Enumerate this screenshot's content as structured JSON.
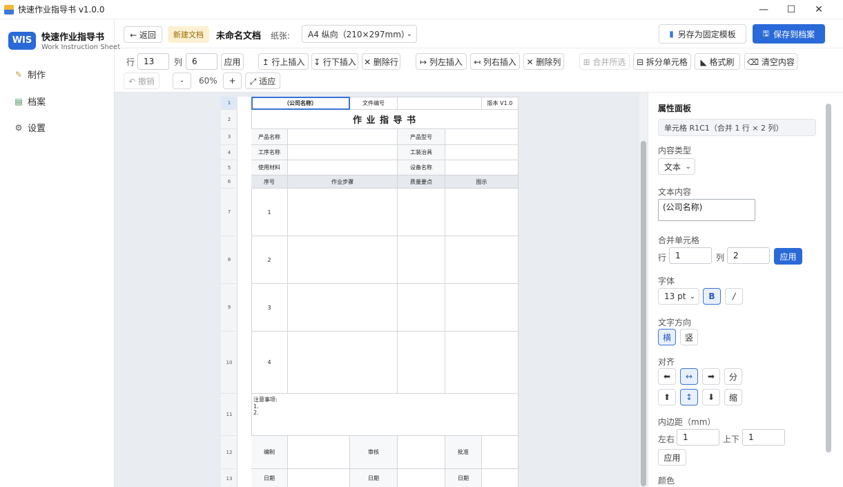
{
  "window": {
    "title": "快速作业指导书 v1.0.0",
    "minimize": "—",
    "maximize": "☐",
    "close": "✕"
  },
  "brand": {
    "logo": "WIS",
    "title": "快速作业指导书",
    "subtitle": "Work Instruction Sheet"
  },
  "nav": [
    {
      "icon": "pencil-icon",
      "glyph": "✎",
      "label": "制作"
    },
    {
      "icon": "archive-icon",
      "glyph": "▤",
      "label": "档案"
    },
    {
      "icon": "gear-icon",
      "glyph": "⚙",
      "label": "设置"
    }
  ],
  "top": {
    "back": "← 返回",
    "badge": "新建文档",
    "doc_title": "未命名文档",
    "paper_label": "纸张:",
    "paper_value": "A4 纵向（210×297mm）",
    "save_template": "另存为固定模板",
    "save_archive": "保存到档案"
  },
  "toolbar": {
    "row_label": "行",
    "row_value": "13",
    "col_label": "列",
    "col_value": "6",
    "apply": "应用",
    "insert_row_above": "↥ 行上插入",
    "insert_row_below": "↧ 行下插入",
    "delete_row": "✕ 删除行",
    "insert_col_left": "↦ 列左插入",
    "insert_col_right": "↤ 列右插入",
    "delete_col": "✕ 删除列",
    "merge": "⊞ 合并所选",
    "split": "⊟ 拆分单元格",
    "format_painter": "◣ 格式刷",
    "clear": "⌫ 清空内容",
    "undo": "↶ 撤销",
    "zoom_out": "-",
    "zoom": "60%",
    "zoom_in": "+",
    "fit": "⤢ 适应"
  },
  "sheet": {
    "rownums": [
      "1",
      "2",
      "3",
      "4",
      "5",
      "6",
      "7",
      "8",
      "9",
      "10",
      "11",
      "12",
      "13"
    ],
    "company": "（公司名称）",
    "doc_no_label": "文件编号",
    "version": "版本 V1.0",
    "title": "作 业 指 导 书",
    "product_name": "产品名称",
    "product_model": "产品型号",
    "process_name": "工序名称",
    "fixture": "工装治具",
    "material": "使用材料",
    "equipment": "设备名称",
    "h_no": "序号",
    "h_step": "作业步骤",
    "h_quality": "质量要点",
    "h_diagram": "图示",
    "steps": [
      "1",
      "2",
      "3",
      "4"
    ],
    "notes_title": "注意事项:",
    "note1": "1.",
    "note2": "2.",
    "prepare": "编制",
    "review": "审核",
    "approve": "批准",
    "date1": "日期",
    "date2": "日期",
    "date3": "日期"
  },
  "panel": {
    "title": "属性面板",
    "cell_info": "单元格 R1C1（合并 1 行 × 2 列）",
    "content_type_label": "内容类型",
    "content_type": "文本",
    "text_label": "文本内容",
    "text_value": "(公司名称)",
    "merge_label": "合并单元格",
    "merge_row_label": "行",
    "merge_row": "1",
    "merge_col_label": "列",
    "merge_col": "2",
    "apply": "应用",
    "font_label": "字体",
    "font_size": "13 pt",
    "bold": "B",
    "italic": "/",
    "dir_label": "文字方向",
    "dir_h": "横",
    "dir_v": "竖",
    "align_label": "对齐",
    "align_left": "⬅",
    "align_center": "↔",
    "align_right": "➡",
    "align_dist": "分",
    "valign_top": "⬆",
    "valign_mid": "↕",
    "valign_bottom": "⬇",
    "shrink": "缩",
    "padding_label": "内边距（mm）",
    "pad_lr_label": "左右",
    "pad_lr": "1",
    "pad_tb_label": "上下",
    "pad_tb": "1",
    "pad_apply": "应用",
    "color_label": "颜色"
  }
}
